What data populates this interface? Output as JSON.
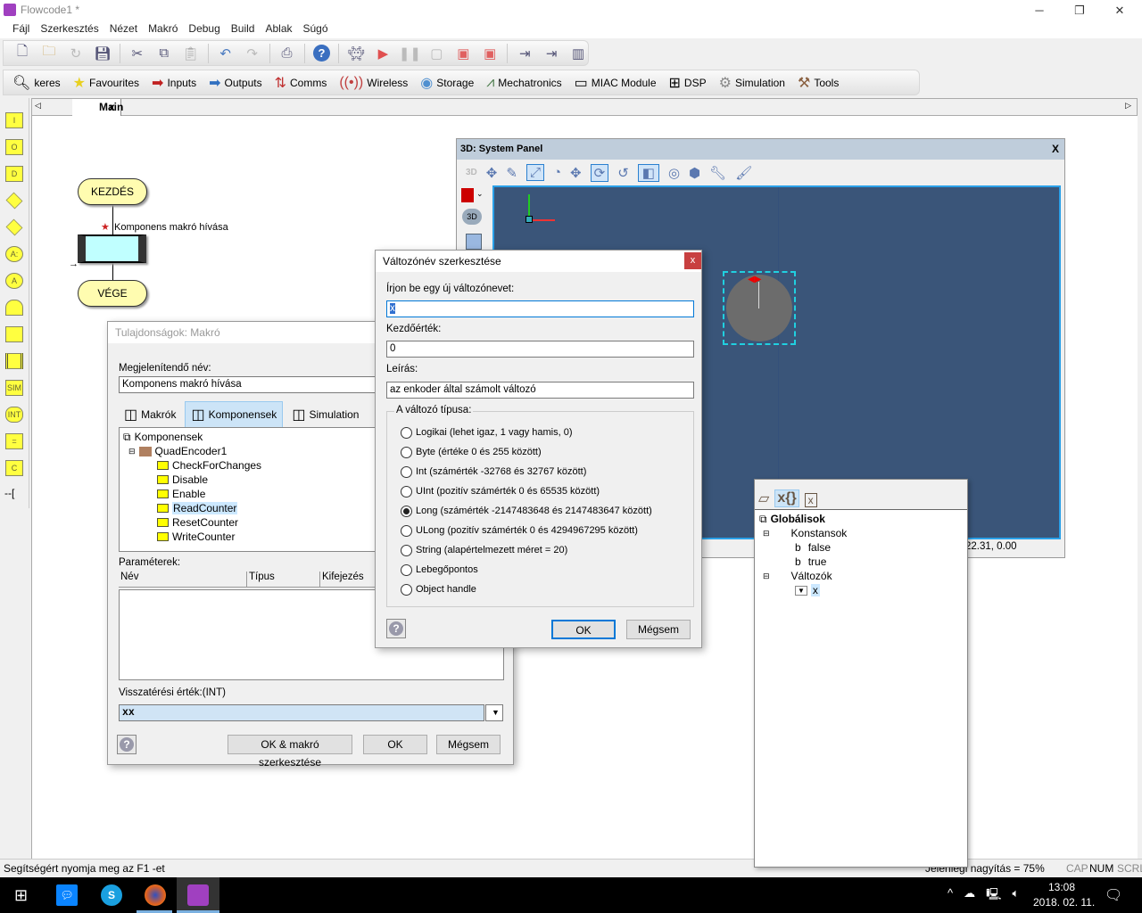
{
  "window": {
    "title": "Flowcode1 *",
    "minimize": "─",
    "maximize": "❐",
    "close": "✕"
  },
  "menu": [
    "Fájl",
    "Szerkesztés",
    "Nézet",
    "Makró",
    "Debug",
    "Build",
    "Ablak",
    "Súgó"
  ],
  "toolbar_icons": [
    "new-file",
    "open-folder",
    "redo-refresh",
    "save",
    "cut",
    "copy",
    "paste",
    "undo",
    "redo",
    "print",
    "help",
    "ghost",
    "play",
    "pause",
    "stop",
    "step-into",
    "step-over",
    "component-in",
    "component-data",
    "chip"
  ],
  "categories": [
    {
      "label": "keres",
      "icon": "search-icon"
    },
    {
      "label": "Favourites",
      "icon": "star-icon"
    },
    {
      "label": "Inputs",
      "icon": "inputs-icon"
    },
    {
      "label": "Outputs",
      "icon": "outputs-icon"
    },
    {
      "label": "Comms",
      "icon": "comms-icon"
    },
    {
      "label": "Wireless",
      "icon": "wireless-icon"
    },
    {
      "label": "Storage",
      "icon": "disc-icon"
    },
    {
      "label": "Mechatronics",
      "icon": "robot-arm-icon"
    },
    {
      "label": "MIAC Module",
      "icon": "miac-icon"
    },
    {
      "label": "DSP",
      "icon": "dsp-icon"
    },
    {
      "label": "Simulation",
      "icon": "gear-icon"
    },
    {
      "label": "Tools",
      "icon": "tools-icon"
    }
  ],
  "tabs": {
    "main": "Main",
    "close": "x"
  },
  "palette": [
    "I",
    "O",
    "D",
    "",
    "",
    "A:",
    "A",
    "",
    "",
    "",
    "SIM",
    "INT",
    "=",
    "C",
    "--["
  ],
  "flowchart": {
    "start": "KEZDÉS",
    "end": "VÉGE",
    "macro_label": "Komponens makró hívása"
  },
  "status": {
    "help": "Segítségért nyomja meg az F1 -et",
    "zoom": "Jelenlegi nagyítás = 75%",
    "cap": "CAP",
    "num": "NUM",
    "scrl": "SCRL"
  },
  "taskbar": {
    "time": "13:08",
    "date": "2018. 02. 11."
  },
  "panel3d": {
    "title": "3D: System Panel",
    "close": "X",
    "label3d": "3D",
    "coords": "22.31, 0.00",
    "accent": "#3a5579"
  },
  "props": {
    "title": "Tulajdonságok: Makró",
    "display_name_label": "Megjelenítendő név:",
    "display_name": "Komponens makró hívása",
    "tabs": [
      "Makrók",
      "Komponensek",
      "Simulation"
    ],
    "tree_root": "Komponensek",
    "component": "QuadEncoder1",
    "macros": [
      "CheckForChanges",
      "Disable",
      "Enable",
      "ReadCounter",
      "ResetCounter",
      "WriteCounter"
    ],
    "selected_macro": "ReadCounter",
    "params_label": "Paraméterek:",
    "columns": [
      "Név",
      "Típus",
      "Kifejezés"
    ],
    "return_label": "Visszatérési érték:(INT)",
    "return_value": "xx",
    "ok_edit": "OK & makró szerkesztése",
    "ok": "OK",
    "cancel": "Mégsem"
  },
  "vardlg": {
    "title": "Változónév szerkesztése",
    "close": "x",
    "name_label": "Írjon be egy új változónevet:",
    "name_value": "x",
    "init_label": "Kezdőérték:",
    "init_value": "0",
    "desc_label": "Leírás:",
    "desc_value": "az enkoder által számolt változó",
    "type_label": "A változó típusa:",
    "types": [
      "Logikai (lehet igaz, 1 vagy hamis, 0)",
      "Byte (értéke 0 és 255 között)",
      "Int (számérték -32768 és 32767 között)",
      "UInt (pozitív számérték 0 és 65535 között)",
      "Long (számérték -2147483648 és 2147483647 között)",
      "ULong (pozitív számérték 0 és 4294967295 között)",
      "String (alapértelmezett méret = 20)",
      "Lebegőpontos",
      "Object handle"
    ],
    "selected_type": "Long (számérték -2147483648 és 2147483647 között)",
    "ok": "OK",
    "cancel": "Mégsem"
  },
  "globals": {
    "root": "Globálisok",
    "constants": "Konstansok",
    "const_items": [
      "false",
      "true"
    ],
    "variables": "Változók",
    "var_items": [
      "x"
    ]
  }
}
